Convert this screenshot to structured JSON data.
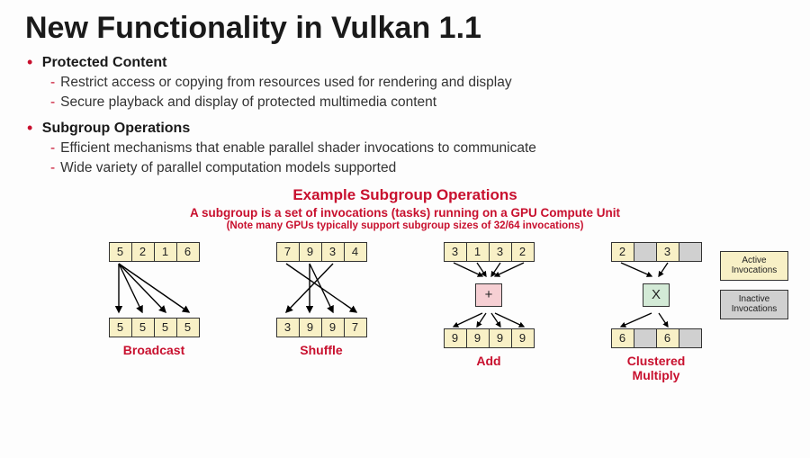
{
  "title": "New Functionality in Vulkan 1.1",
  "bullets": [
    {
      "label": "Protected Content",
      "subs": [
        "Restrict access or copying from resources used for rendering and display",
        "Secure playback and display of protected multimedia content"
      ]
    },
    {
      "label": "Subgroup Operations",
      "subs": [
        "Efficient mechanisms that enable parallel shader invocations to communicate",
        "Wide variety of parallel computation models supported"
      ]
    }
  ],
  "diagram_header": {
    "title": "Example Subgroup Operations",
    "subtitle": "A subgroup is a set of invocations (tasks) running on a GPU Compute Unit",
    "note": "(Note many GPUs typically support subgroup sizes of 32/64 invocations)"
  },
  "diagrams": {
    "broadcast": {
      "label": "Broadcast",
      "top": [
        "5",
        "2",
        "1",
        "6"
      ],
      "bottom": [
        "5",
        "5",
        "5",
        "5"
      ]
    },
    "shuffle": {
      "label": "Shuffle",
      "top": [
        "7",
        "9",
        "3",
        "4"
      ],
      "bottom": [
        "3",
        "9",
        "9",
        "7"
      ]
    },
    "add": {
      "label": "Add",
      "top": [
        "3",
        "1",
        "3",
        "2"
      ],
      "op": "+",
      "bottom": [
        "9",
        "9",
        "9",
        "9"
      ]
    },
    "clustered": {
      "label": "Clustered\nMultiply",
      "top": [
        "2",
        "",
        "3",
        ""
      ],
      "op": "X",
      "bottom": [
        "6",
        "",
        "6",
        ""
      ],
      "inactive_idx": [
        1,
        3
      ]
    }
  },
  "legend": {
    "active": "Active\nInvocations",
    "inactive": "Inactive\nInvocations"
  }
}
